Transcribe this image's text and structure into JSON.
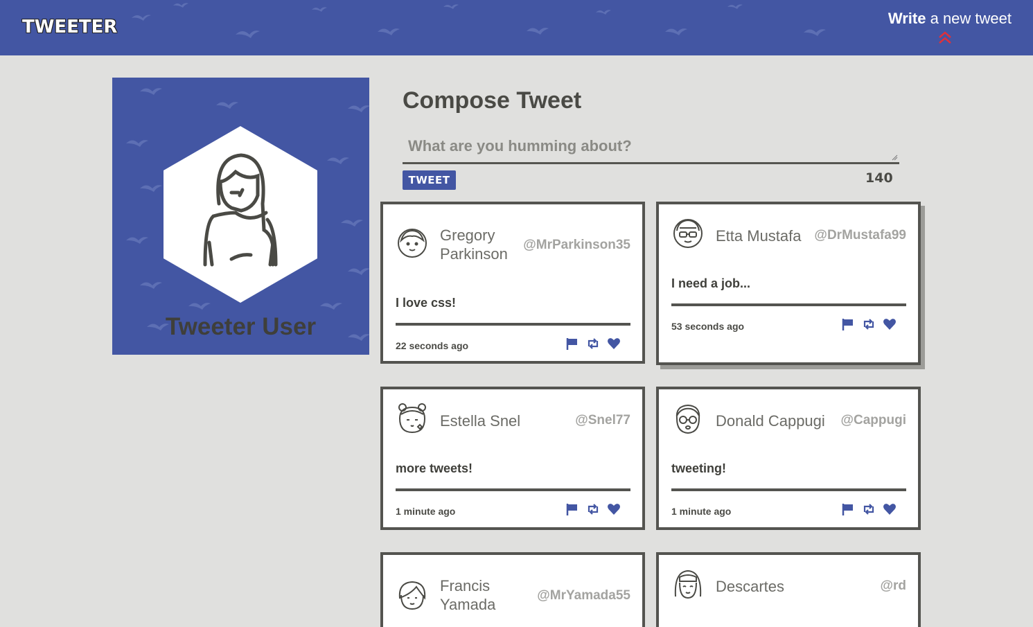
{
  "nav": {
    "brand": "TWEETER",
    "write_bold": "Write",
    "write_rest": "a new tweet"
  },
  "profile": {
    "name": "Tweeter User"
  },
  "compose": {
    "title": "Compose Tweet",
    "placeholder": "What are you humming about?",
    "button": "TWEET",
    "counter": "140"
  },
  "tweets": [
    {
      "name": "Gregory Parkinson",
      "handle": "@MrParkinson35",
      "body": "I love css!",
      "time": "22 seconds ago"
    },
    {
      "name": "Etta Mustafa",
      "handle": "@DrMustafa99",
      "body": "I need a job...",
      "time": "53 seconds ago"
    },
    {
      "name": "Estella Snel",
      "handle": "@Snel77",
      "body": "more tweets!",
      "time": "1 minute ago"
    },
    {
      "name": "Donald Cappugi",
      "handle": "@Cappugi",
      "body": "tweeting!",
      "time": "1 minute ago"
    },
    {
      "name": "Francis Yamada",
      "handle": "@MrYamada55",
      "body": "",
      "time": ""
    },
    {
      "name": "Descartes",
      "handle": "@rd",
      "body": "",
      "time": ""
    }
  ],
  "icons": {
    "flag": "flag-icon",
    "retweet": "retweet-icon",
    "like": "heart-icon"
  },
  "colors": {
    "brand": "#4356a3",
    "background": "#e0e0de",
    "border": "#545450",
    "accent": "#e0303a"
  }
}
